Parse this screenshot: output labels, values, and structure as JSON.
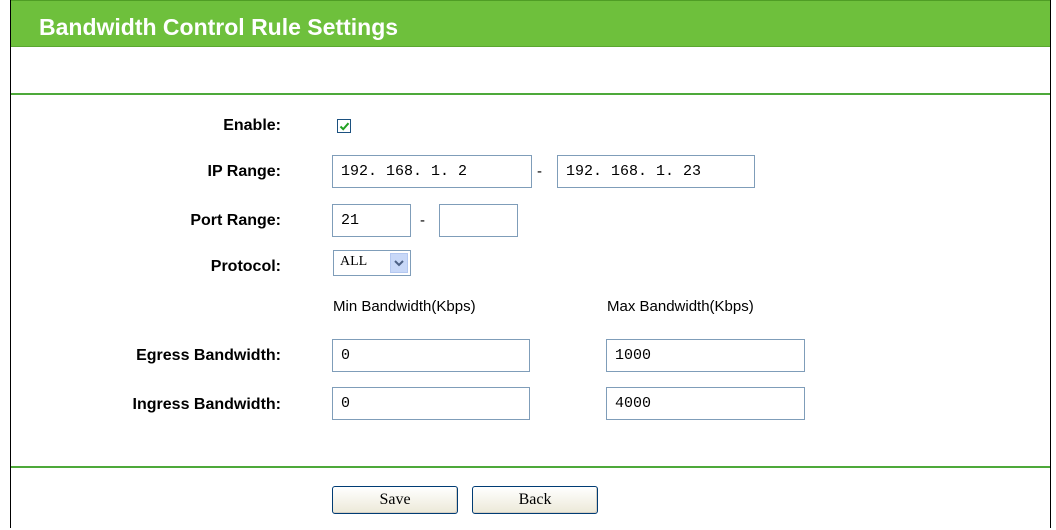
{
  "header": {
    "title": "Bandwidth Control Rule Settings"
  },
  "form": {
    "enable": {
      "label": "Enable:",
      "checked": true
    },
    "ip_range": {
      "label": "IP Range:",
      "start": "192. 168. 1. 2",
      "separator": "-",
      "end": "192. 168. 1. 23"
    },
    "port_range": {
      "label": "Port Range:",
      "start": "21",
      "separator": "-",
      "end": ""
    },
    "protocol": {
      "label": "Protocol:",
      "selected": "ALL"
    },
    "bandwidth_columns": {
      "min": "Min Bandwidth(Kbps)",
      "max": "Max Bandwidth(Kbps)"
    },
    "egress": {
      "label": "Egress Bandwidth:",
      "min": "0",
      "max": "1000"
    },
    "ingress": {
      "label": "Ingress Bandwidth:",
      "min": "0",
      "max": "4000"
    }
  },
  "actions": {
    "save_label": "Save",
    "back_label": "Back"
  },
  "colors": {
    "accent": "#6ec03c",
    "divider": "#4ea93a",
    "input_border": "#7f9db9"
  }
}
